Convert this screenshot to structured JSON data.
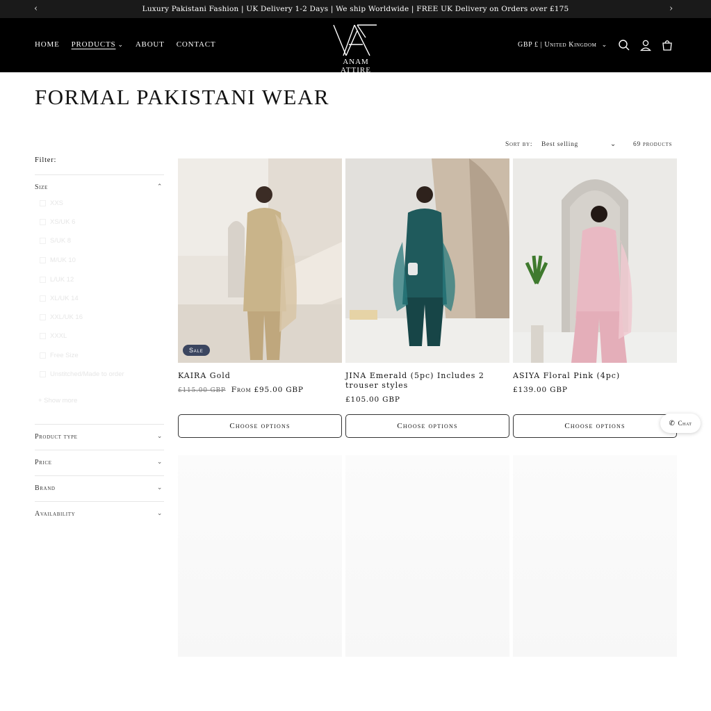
{
  "announcement": {
    "text": "Luxury Pakistani Fashion | UK Delivery 1-2 Days | We ship Worldwide | FREE UK Delivery on Orders over £175",
    "prev_icon": "chevron-left-icon",
    "next_icon": "chevron-right-icon"
  },
  "header": {
    "nav": [
      "HOME",
      "PRODUCTS",
      "ABOUT",
      "CONTACT"
    ],
    "logo_text": "ANAM ATTIRE",
    "locale": "GBP £ | United Kingdom",
    "icons": [
      "search-icon",
      "account-icon",
      "cart-icon"
    ]
  },
  "page": {
    "title": "FORMAL PAKISTANI WEAR"
  },
  "sort": {
    "label": "Sort by:",
    "value": "Best selling",
    "count": "69 products"
  },
  "filters": {
    "label": "Filter:",
    "groups": [
      "Size",
      "Product type",
      "Price",
      "Brand",
      "Availability"
    ],
    "size_options": [
      "XXS",
      "XS/UK 6",
      "S/UK 8",
      "M/UK 10",
      "L/UK 12",
      "XL/UK 14",
      "XXL/UK 16",
      "XXXL",
      "Free Size",
      "Unstitched/Made to order"
    ],
    "show_more": "+ Show more"
  },
  "products": [
    {
      "name": "KAIRA Gold",
      "badge": "Sale",
      "old_price": "£115.00 GBP",
      "price": "From £95.00 GBP",
      "button": "Choose options",
      "accent": "#c9b48a"
    },
    {
      "name": "JINA Emerald (5pc) Includes 2 trouser styles",
      "price": "£105.00 GBP",
      "button": "Choose options",
      "accent": "#1f5a5c"
    },
    {
      "name": "ASIYA Floral Pink (4pc)",
      "price": "£139.00 GBP",
      "button": "Choose options",
      "accent": "#e9b9c3"
    }
  ],
  "chat": {
    "label": "Chat",
    "icon": "chat-icon"
  }
}
